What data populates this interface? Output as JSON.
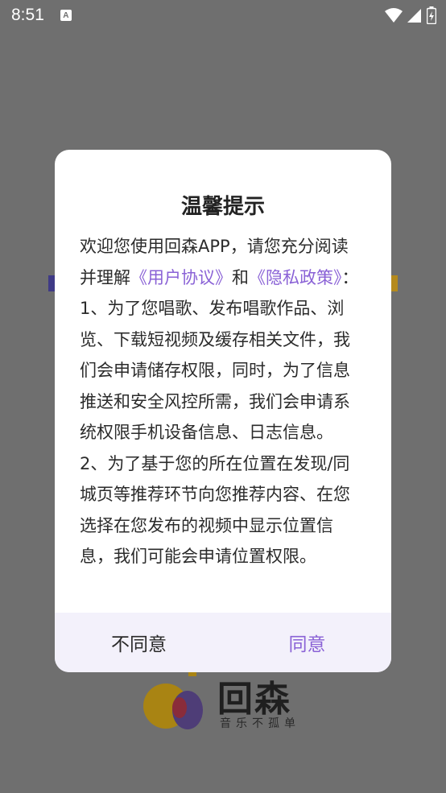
{
  "status_bar": {
    "time": "8:51",
    "notif_icon_glyph": "A"
  },
  "dialog": {
    "title": "温馨提示",
    "intro_pre": "欢迎您使用回森APP，请您充分阅读并理解",
    "link_user_agreement": "《用户协议》",
    "and_text": "和",
    "link_privacy_policy": "《隐私政策》",
    "intro_post": "：",
    "para1": "1、为了您唱歌、发布唱歌作品、浏览、下载短视频及缓存相关文件，我们会申请储存权限，同时，为了信息推送和安全风控所需，我们会申请系统权限手机设备信息、日志信息。",
    "para2": "2、为了基于您的所在位置在发现/同城页等推荐环节向您推荐内容、在您选择在您发布的视频中显示位置信息，我们可能会申请位置权限。",
    "disagree_label": "不同意",
    "agree_label": "同意"
  },
  "background": {
    "logo_title": "回森",
    "logo_subtitle": "音乐不孤单"
  },
  "colors": {
    "accent": "#8a62d6",
    "overlay": "#6f6f6f",
    "footer_bg": "#f3f1fb"
  }
}
